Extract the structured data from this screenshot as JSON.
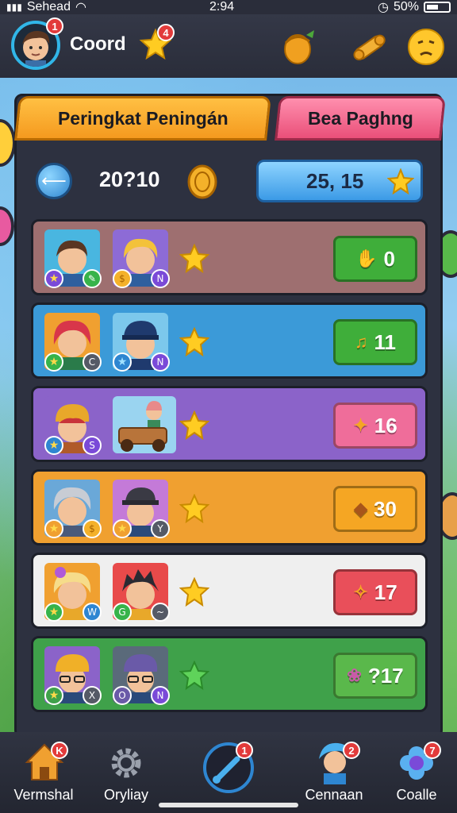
{
  "status_bar": {
    "carrier": "Sehead",
    "time": "2:94",
    "battery": "50%"
  },
  "header": {
    "player_name": "Coord",
    "avatar_badge": "1",
    "star_badge": "4"
  },
  "tabs": [
    {
      "label": "Peringkat Peningán",
      "active": true
    },
    {
      "label": "Bea Paghng",
      "active": false
    }
  ],
  "toolbar": {
    "coin_count": "20?10",
    "score": "25, 15"
  },
  "rows": [
    {
      "reward": "0",
      "color": "#9e6f70",
      "button_color": "#3fae3a"
    },
    {
      "reward": "11",
      "color": "#3b9ad8",
      "button_color": "#3fae3a"
    },
    {
      "reward": "16",
      "color": "#8b63c9",
      "button_color": "#ef6d9a"
    },
    {
      "reward": "30",
      "color": "#f0a030",
      "button_color": "#f5a623"
    },
    {
      "reward": "17",
      "color": "#efefef",
      "button_color": "#e94f5a"
    },
    {
      "reward": "?17",
      "color": "#3fa14a",
      "button_color": "#5ab84b"
    }
  ],
  "bottom_nav": [
    {
      "label": "Vermshal",
      "badge": "K"
    },
    {
      "label": "Oryliay",
      "badge": ""
    },
    {
      "label": "",
      "badge": "1"
    },
    {
      "label": "Cennaan",
      "badge": "2"
    },
    {
      "label": "Coalle",
      "badge": "7"
    }
  ]
}
